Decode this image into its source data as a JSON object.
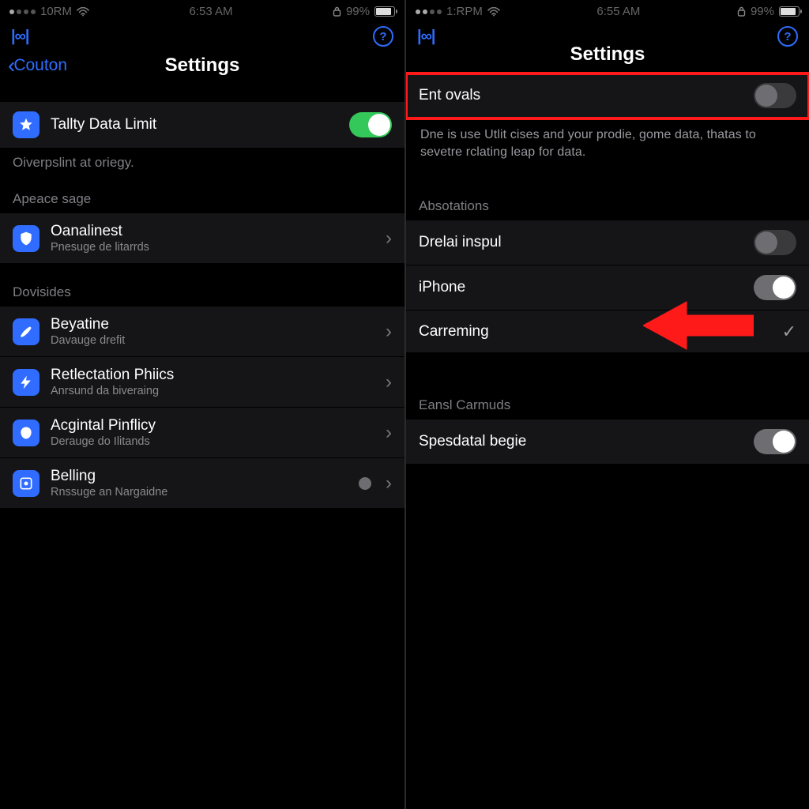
{
  "left": {
    "status": {
      "time_left": "10RM",
      "time_center": "6:53 AM",
      "pct": "99%"
    },
    "logo": "|∞|",
    "back_label": "Couton",
    "title": "Settings",
    "row_data_limit": {
      "label": "Tallty Data Limit"
    },
    "footer": "Oiverpslint at oriegy.",
    "section_usage": "Apeace sage",
    "row_oanalinest": {
      "label": "Oanalinest",
      "sub": "Pnesuge de litarrds"
    },
    "section_devices": "Dovisides",
    "row_beyatine": {
      "label": "Beyatine",
      "sub": "Davauge drefit"
    },
    "row_retlectation": {
      "label": "Retlectation Phiics",
      "sub": "Anrsund da biveraing"
    },
    "row_acgintal": {
      "label": "Acgintal Pinflicy",
      "sub": "Derauge do Ilitands"
    },
    "row_belling": {
      "label": "Belling",
      "sub": "Rnssuge an Nargaidne"
    }
  },
  "right": {
    "status": {
      "time_left": "1:RPM",
      "time_center": "6:55 AM",
      "pct": "99%"
    },
    "logo": "|∞|",
    "title": "Settings",
    "row_ent_ovals": {
      "label": "Ent ovals"
    },
    "desc": "Dne is use Utlit cises and your prodie, gome data, thatas to sevetre rclating leap for data.",
    "section_absotations": "Absotations",
    "row_drelai": {
      "label": "Drelai inspul"
    },
    "row_iphone": {
      "label": "iPhone"
    },
    "row_carreming": {
      "label": "Carreming"
    },
    "section_eansl": "Eansl Carmuds",
    "row_spesdatal": {
      "label": "Spesdatal begie"
    }
  }
}
